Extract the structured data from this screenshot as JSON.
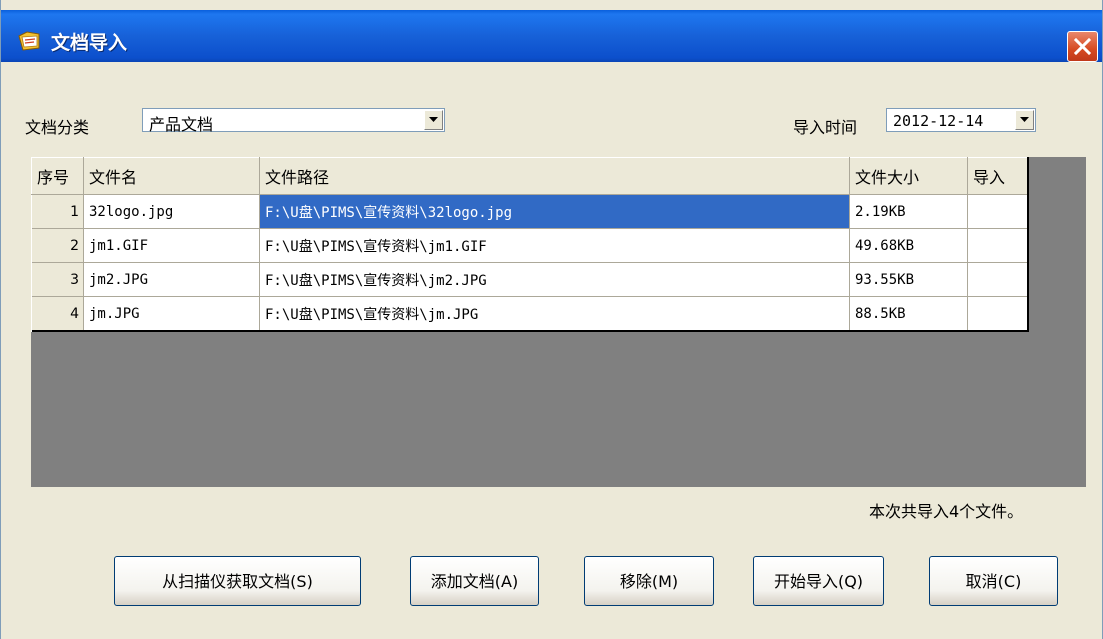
{
  "window": {
    "title": "文档导入",
    "close_label": "close"
  },
  "filters": {
    "category_label": "文档分类",
    "category_value": "产品文档",
    "import_time_label": "导入时间",
    "import_time_value": "2012-12-14"
  },
  "table": {
    "headers": [
      "序号",
      "文件名",
      "文件路径",
      "文件大小",
      "导入"
    ],
    "rows": [
      {
        "seq": "1",
        "name": "32logo.jpg",
        "path": "F:\\U盘\\PIMS\\宣传资料\\32logo.jpg",
        "size": "2.19KB",
        "import": ""
      },
      {
        "seq": "2",
        "name": "jm1.GIF",
        "path": "F:\\U盘\\PIMS\\宣传资料\\jm1.GIF",
        "size": "49.68KB",
        "import": ""
      },
      {
        "seq": "3",
        "name": "jm2.JPG",
        "path": "F:\\U盘\\PIMS\\宣传资料\\jm2.JPG",
        "size": "93.55KB",
        "import": ""
      },
      {
        "seq": "4",
        "name": "jm.JPG",
        "path": "F:\\U盘\\PIMS\\宣传资料\\jm.JPG",
        "size": "88.5KB",
        "import": ""
      }
    ]
  },
  "status_text": "本次共导入4个文件。",
  "buttons": {
    "scan": "从扫描仪获取文档(S)",
    "add": "添加文档(A)",
    "remove": "移除(M)",
    "start": "开始导入(Q)",
    "cancel": "取消(C)"
  },
  "icons": {
    "app": "document-folder-icon",
    "close": "close-icon",
    "dropdown": "chevron-down-icon"
  },
  "colors": {
    "titlebar": "#1761d8",
    "selection": "#316ac5",
    "grid_background": "#808080",
    "dialog": "#ece9d8"
  }
}
